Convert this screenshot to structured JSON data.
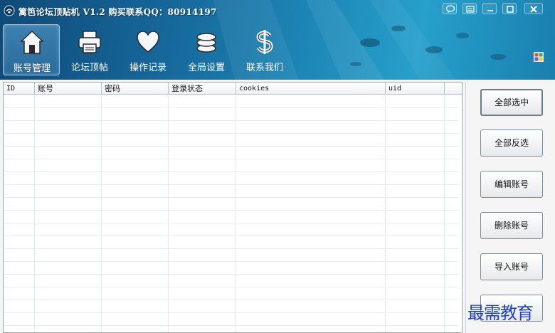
{
  "window": {
    "title": "篱笆论坛顶贴机 V1.2 购买联系QQ：80914197"
  },
  "toolbar": {
    "items": [
      {
        "label": "账号管理",
        "icon": "home-icon",
        "active": true
      },
      {
        "label": "论坛顶帖",
        "icon": "printer-icon",
        "active": false
      },
      {
        "label": "操作记录",
        "icon": "heart-icon",
        "active": false
      },
      {
        "label": "全局设置",
        "icon": "coins-icon",
        "active": false
      },
      {
        "label": "联系我们",
        "icon": "dollar-icon",
        "active": false
      }
    ]
  },
  "table": {
    "columns": [
      "ID",
      "账号",
      "密码",
      "登录状态",
      "cookies",
      "uid"
    ],
    "rows": []
  },
  "side_panel": {
    "buttons": [
      "全部选中",
      "全部反选",
      "编辑账号",
      "删除账号",
      "导入账号"
    ]
  },
  "watermark": "最需教育",
  "colors": {
    "header_dark": "#0f4a78",
    "header_light": "#27a0cb",
    "watermark": "#1f3fbd"
  }
}
